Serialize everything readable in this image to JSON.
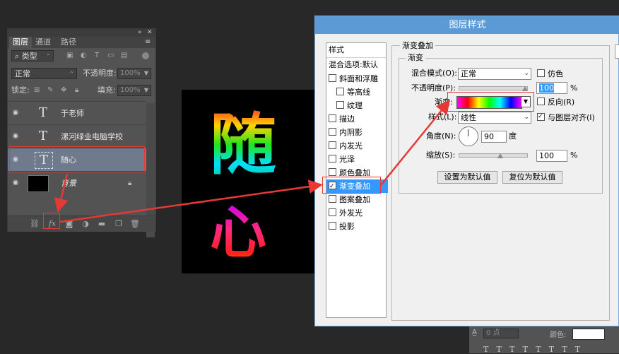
{
  "layers_panel": {
    "tabs": [
      "图层",
      "通道",
      "路径"
    ],
    "filter": {
      "kind": "类型"
    },
    "blend_mode": "正常",
    "opacity_label": "不透明度:",
    "opacity_value": "100%",
    "lock_label": "锁定:",
    "fill_label": "填充:",
    "fill_value": "100%",
    "layers": [
      {
        "name": "于老师",
        "type": "text"
      },
      {
        "name": "漯河绿业电脑学校",
        "type": "text"
      },
      {
        "name": "随心",
        "type": "text",
        "selected": true
      },
      {
        "name": "背景",
        "type": "background"
      }
    ],
    "bottom_icons": [
      "link-icon",
      "fx-icon",
      "mask-icon",
      "adjustment-icon",
      "folder-icon",
      "new-layer-icon",
      "trash-icon"
    ]
  },
  "canvas": {
    "chars": [
      "随",
      "心"
    ]
  },
  "dialog": {
    "title": "图层样式",
    "style_list": {
      "header": "样式",
      "items": [
        {
          "label": "混合选项:默认",
          "checkbox": false
        },
        {
          "label": "斜面和浮雕",
          "checkbox": true,
          "checked": false
        },
        {
          "label": "等高线",
          "checkbox": true,
          "checked": false,
          "indent": true
        },
        {
          "label": "纹理",
          "checkbox": true,
          "checked": false,
          "indent": true
        },
        {
          "label": "描边",
          "checkbox": true,
          "checked": false
        },
        {
          "label": "内阴影",
          "checkbox": true,
          "checked": false
        },
        {
          "label": "内发光",
          "checkbox": true,
          "checked": false
        },
        {
          "label": "光泽",
          "checkbox": true,
          "checked": false
        },
        {
          "label": "颜色叠加",
          "checkbox": true,
          "checked": false
        },
        {
          "label": "渐变叠加",
          "checkbox": true,
          "checked": true,
          "active": true
        },
        {
          "label": "图案叠加",
          "checkbox": true,
          "checked": false
        },
        {
          "label": "外发光",
          "checkbox": true,
          "checked": false
        },
        {
          "label": "投影",
          "checkbox": true,
          "checked": false
        }
      ]
    },
    "gradient_overlay": {
      "section_title": "渐变叠加",
      "group_title": "渐变",
      "blend_mode_label": "混合模式(O):",
      "blend_mode_value": "正常",
      "dither_label": "仿色",
      "opacity_label": "不透明度(P):",
      "opacity_value": "100",
      "percent": "%",
      "gradient_label": "渐变:",
      "reverse_label": "反向(R)",
      "style_label": "样式(L):",
      "style_value": "线性",
      "align_label": "与图层对齐(I)",
      "angle_label": "角度(N):",
      "angle_value": "90",
      "degree": "度",
      "scale_label": "缩放(S):",
      "scale_value": "100",
      "set_default": "设置为默认值",
      "reset_default": "复位为默认值"
    }
  },
  "char_panel": {
    "field_value": "0 点",
    "color_label": "颜色:"
  }
}
